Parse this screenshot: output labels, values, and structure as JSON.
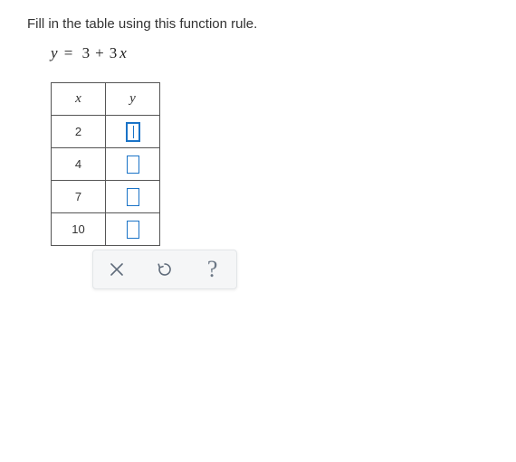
{
  "instruction": "Fill in the table using this function rule.",
  "equation": {
    "lhs": "y",
    "eq": "=",
    "c1": "3",
    "plus": "+",
    "c2": "3",
    "var": "x"
  },
  "table": {
    "headers": {
      "x": "x",
      "y": "y"
    },
    "rows": [
      {
        "x": "2",
        "y": "",
        "active": true
      },
      {
        "x": "4",
        "y": "",
        "active": false
      },
      {
        "x": "7",
        "y": "",
        "active": false
      },
      {
        "x": "10",
        "y": "",
        "active": false
      }
    ]
  },
  "toolbar": {
    "clear": "×",
    "reset": "↺",
    "help": "?"
  }
}
